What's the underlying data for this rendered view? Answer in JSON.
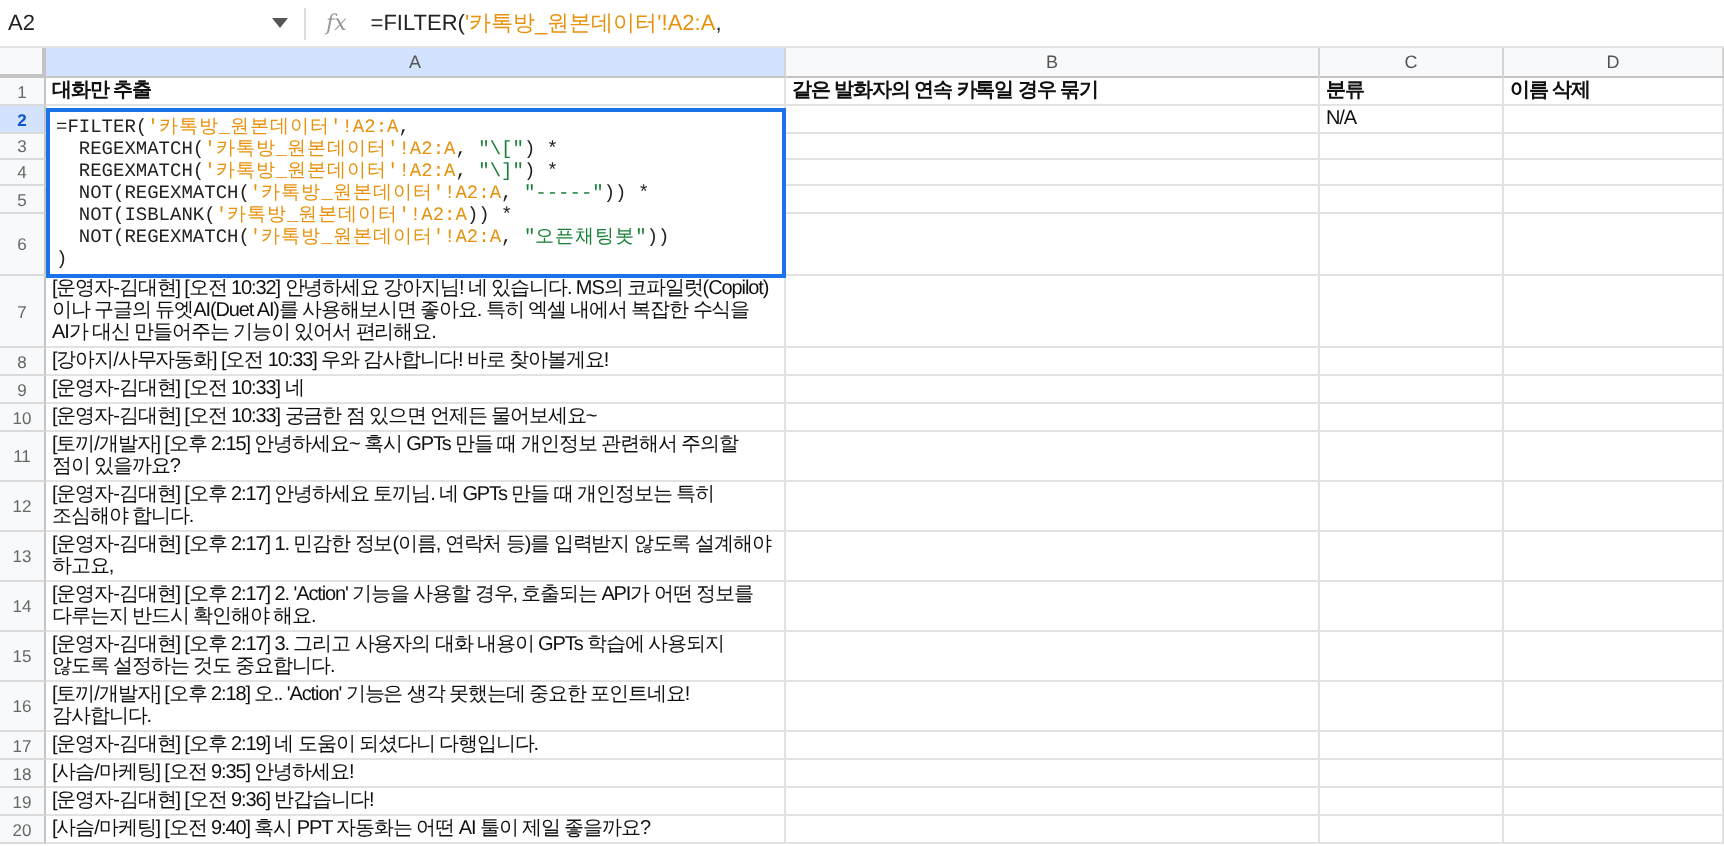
{
  "name_box": {
    "value": "A2"
  },
  "formula_bar": {
    "icon_text": "fx",
    "segments": [
      {
        "kind": "plain",
        "text": "=FILTER("
      },
      {
        "kind": "range",
        "text": "'카톡방_원본데이터'!A2:A"
      },
      {
        "kind": "plain",
        "text": ","
      }
    ]
  },
  "columns": [
    {
      "label": "A",
      "selected": true
    },
    {
      "label": "B",
      "selected": false
    },
    {
      "label": "C",
      "selected": false
    },
    {
      "label": "D",
      "selected": false
    }
  ],
  "editor": {
    "lines": [
      [
        {
          "kind": "plain",
          "text": "=FILTER("
        },
        {
          "kind": "range",
          "text": "'카톡방_원본데이터'!A2:A"
        },
        {
          "kind": "plain",
          "text": ","
        }
      ],
      [
        {
          "kind": "plain",
          "text": "  REGEXMATCH("
        },
        {
          "kind": "range",
          "text": "'카톡방_원본데이터'!A2:A"
        },
        {
          "kind": "plain",
          "text": ", "
        },
        {
          "kind": "string",
          "text": "\"\\[\""
        },
        {
          "kind": "plain",
          "text": ") *"
        }
      ],
      [
        {
          "kind": "plain",
          "text": "  REGEXMATCH("
        },
        {
          "kind": "range",
          "text": "'카톡방_원본데이터'!A2:A"
        },
        {
          "kind": "plain",
          "text": ", "
        },
        {
          "kind": "string",
          "text": "\"\\]\""
        },
        {
          "kind": "plain",
          "text": ") *"
        }
      ],
      [
        {
          "kind": "plain",
          "text": "  NOT(REGEXMATCH("
        },
        {
          "kind": "range",
          "text": "'카톡방_원본데이터'!A2:A"
        },
        {
          "kind": "plain",
          "text": ", "
        },
        {
          "kind": "string",
          "text": "\"-----\""
        },
        {
          "kind": "plain",
          "text": ")) *"
        }
      ],
      [
        {
          "kind": "plain",
          "text": "  NOT(ISBLANK("
        },
        {
          "kind": "range",
          "text": "'카톡방_원본데이터'!A2:A"
        },
        {
          "kind": "plain",
          "text": ")) *"
        }
      ],
      [
        {
          "kind": "plain",
          "text": "  NOT(REGEXMATCH("
        },
        {
          "kind": "range",
          "text": "'카톡방_원본데이터'!A2:A"
        },
        {
          "kind": "plain",
          "text": ", "
        },
        {
          "kind": "string",
          "text": "\"오픈채팅봇\""
        },
        {
          "kind": "plain",
          "text": "))"
        }
      ],
      [
        {
          "kind": "plain",
          "text": ")"
        }
      ]
    ]
  },
  "rows": [
    {
      "number": "1",
      "selected": false,
      "cells": [
        "대화만 추출",
        "같은 발화자의 연속 카톡일 경우 묶기",
        "분류",
        "이름 삭제"
      ]
    },
    {
      "number": "2",
      "selected": true,
      "cells": [
        "",
        "",
        "N/A",
        ""
      ]
    },
    {
      "number": "3",
      "selected": false,
      "cells": [
        "",
        "",
        "",
        ""
      ]
    },
    {
      "number": "4",
      "selected": false,
      "cells": [
        "",
        "",
        "",
        ""
      ]
    },
    {
      "number": "5",
      "selected": false,
      "cells": [
        "",
        "",
        "",
        ""
      ]
    },
    {
      "number": "6",
      "selected": false,
      "cells": [
        "",
        "",
        "",
        ""
      ]
    },
    {
      "number": "7",
      "selected": false,
      "cells": [
        "[운영자-김대현] [오전 10:32] 안녕하세요 강아지님! 네 있습니다. MS의 코파일럿(Copilot)이나 구글의 듀엣AI(Duet AI)를 사용해보시면 좋아요. 특히 엑셀 내에서 복잡한 수식을 AI가 대신 만들어주는 기능이 있어서 편리해요.",
        "",
        "",
        ""
      ]
    },
    {
      "number": "8",
      "selected": false,
      "cells": [
        "[강아지/사무자동화] [오전 10:33] 우와 감사합니다! 바로 찾아볼게요!",
        "",
        "",
        ""
      ]
    },
    {
      "number": "9",
      "selected": false,
      "cells": [
        "[운영자-김대현] [오전 10:33] 네",
        "",
        "",
        ""
      ]
    },
    {
      "number": "10",
      "selected": false,
      "cells": [
        "[운영자-김대현] [오전 10:33] 궁금한 점 있으면 언제든 물어보세요~",
        "",
        "",
        ""
      ]
    },
    {
      "number": "11",
      "selected": false,
      "cells": [
        "[토끼/개발자] [오후 2:15] 안녕하세요~ 혹시 GPTs 만들 때 개인정보 관련해서 주의할 점이 있을까요?",
        "",
        "",
        ""
      ]
    },
    {
      "number": "12",
      "selected": false,
      "cells": [
        "[운영자-김대현] [오후 2:17] 안녕하세요 토끼님. 네 GPTs 만들 때 개인정보는 특히 조심해야 합니다.",
        "",
        "",
        ""
      ]
    },
    {
      "number": "13",
      "selected": false,
      "cells": [
        "[운영자-김대현] [오후 2:17] 1. 민감한 정보(이름, 연락처 등)를 입력받지 않도록 설계해야 하고요,",
        "",
        "",
        ""
      ]
    },
    {
      "number": "14",
      "selected": false,
      "cells": [
        "[운영자-김대현] [오후 2:17] 2. 'Action' 기능을 사용할 경우, 호출되는 API가 어떤 정보를 다루는지 반드시 확인해야 해요.",
        "",
        "",
        ""
      ]
    },
    {
      "number": "15",
      "selected": false,
      "cells": [
        "[운영자-김대현] [오후 2:17] 3. 그리고 사용자의 대화 내용이 GPTs 학습에 사용되지 않도록 설정하는 것도 중요합니다.",
        "",
        "",
        ""
      ]
    },
    {
      "number": "16",
      "selected": false,
      "cells": [
        "[토끼/개발자] [오후 2:18] 오.. 'Action' 기능은 생각 못했는데 중요한 포인트네요! 감사합니다.",
        "",
        "",
        ""
      ]
    },
    {
      "number": "17",
      "selected": false,
      "cells": [
        "[운영자-김대현] [오후 2:19] 네 도움이 되셨다니 다행입니다.",
        "",
        "",
        ""
      ]
    },
    {
      "number": "18",
      "selected": false,
      "cells": [
        "[사슴/마케팅] [오전 9:35] 안녕하세요!",
        "",
        "",
        ""
      ]
    },
    {
      "number": "19",
      "selected": false,
      "cells": [
        "[운영자-김대현] [오전 9:36] 반갑습니다!",
        "",
        "",
        ""
      ]
    },
    {
      "number": "20",
      "selected": false,
      "cells": [
        "[사슴/마케팅] [오전 9:40] 혹시 PPT 자동화는 어떤 AI 툴이 제일 좋을까요?",
        "",
        "",
        ""
      ]
    }
  ]
}
